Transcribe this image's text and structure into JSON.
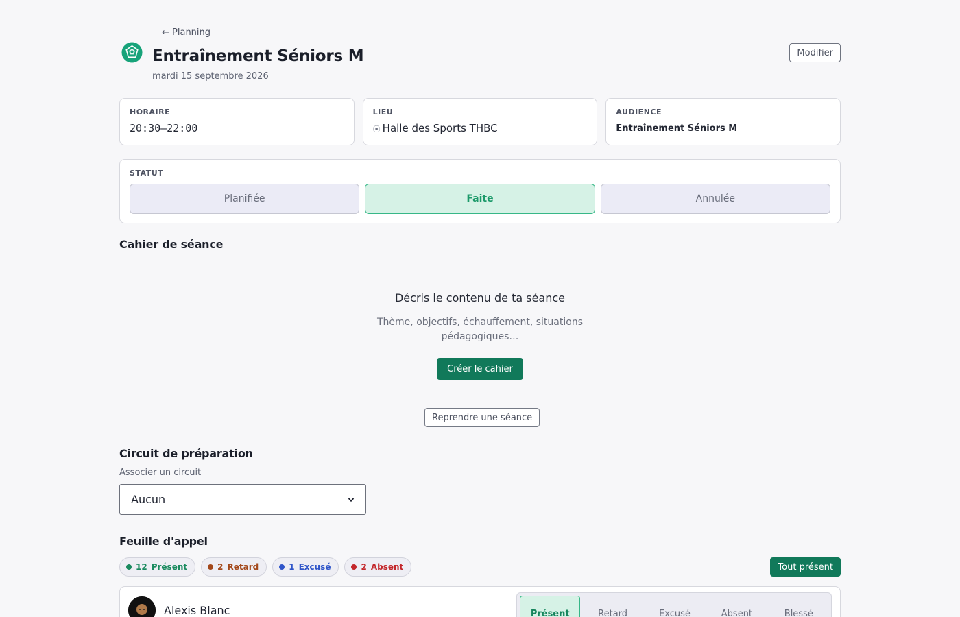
{
  "header": {
    "back_label": "← Planning",
    "title": "Entraînement Séniors M",
    "date": "mardi 15 septembre 2026",
    "edit_label": "Modifier"
  },
  "info": {
    "schedule": {
      "label": "HORAIRE",
      "value": "20:30–22:00"
    },
    "location": {
      "label": "LIEU",
      "value": "Halle des Sports THBC",
      "icon": "pin-icon"
    },
    "audience": {
      "label": "AUDIENCE",
      "value": "Entraînement Séniors M"
    }
  },
  "status": {
    "label": "STATUT",
    "options": [
      "Planifiée",
      "Faite",
      "Annulée"
    ],
    "selected": "Faite"
  },
  "notebook": {
    "title": "Cahier de séance",
    "empty_title": "Décris le contenu de ta séance",
    "empty_desc": "Thème, objectifs, échauffement, situations pédagogiques…",
    "create_label": "Créer le cahier",
    "reuse_label": "Reprendre une séance"
  },
  "circuit": {
    "title": "Circuit de préparation",
    "field_label": "Associer un circuit",
    "selected": "Aucun"
  },
  "attendance": {
    "title": "Feuille d'appel",
    "all_present_label": "Tout présent",
    "badges": [
      {
        "count": "12",
        "label": "Présent",
        "color": "#1a8a5f"
      },
      {
        "count": "2",
        "label": "Retard",
        "color": "#a3481a"
      },
      {
        "count": "1",
        "label": "Excusé",
        "color": "#2f55c9"
      },
      {
        "count": "2",
        "label": "Absent",
        "color": "#c3262a"
      }
    ],
    "players": [
      {
        "name": "Alexis Blanc",
        "options": [
          "Présent",
          "Retard",
          "Excusé",
          "Absent",
          "Blessé"
        ],
        "selected": "Présent"
      }
    ]
  },
  "colors": {
    "accent": "#11795a",
    "active_bg": "#d6f2e6",
    "active_border": "#37b787"
  }
}
